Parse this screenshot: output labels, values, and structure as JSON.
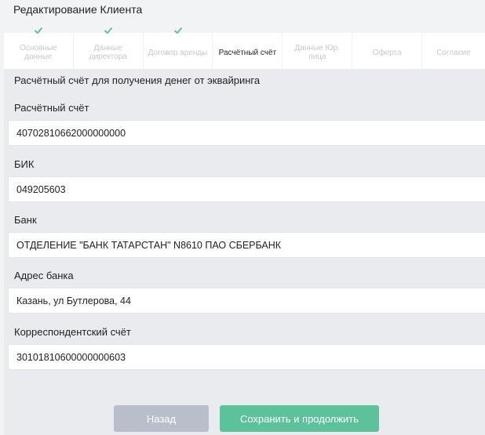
{
  "header": {
    "title": "Редактирование Клиента"
  },
  "tabs": [
    {
      "label": "Основные данные",
      "completed": true,
      "active": false
    },
    {
      "label": "Данные директора",
      "completed": true,
      "active": false
    },
    {
      "label": "Договор аренды",
      "completed": true,
      "active": false
    },
    {
      "label": "Расчётный счёт",
      "completed": false,
      "active": true
    },
    {
      "label": "Данные Юр. лица",
      "completed": false,
      "active": false
    },
    {
      "label": "Оферта",
      "completed": false,
      "active": false
    },
    {
      "label": "Согласие",
      "completed": false,
      "active": false
    }
  ],
  "form": {
    "section_title": "Расчётный счёт для получения денег от эквайринга",
    "fields": [
      {
        "label": "Расчётный счёт",
        "value": "40702810662000000000"
      },
      {
        "label": "БИК",
        "value": "049205603"
      },
      {
        "label": "Банк",
        "value": "ОТДЕЛЕНИЕ \"БАНК ТАТАРСТАН\" N8610 ПАО СБЕРБАНК"
      },
      {
        "label": "Адрес банка",
        "value": "Казань, ул Бутлерова, 44"
      },
      {
        "label": "Корреспондентский счёт",
        "value": "30101810600000000603"
      }
    ]
  },
  "actions": {
    "back_label": "Назад",
    "save_label": "Сохранить и продолжить"
  },
  "colors": {
    "check": "#5cc29c",
    "save_button": "#5cc29c",
    "back_button": "#b8bfca",
    "panel": "#e9ebef"
  }
}
